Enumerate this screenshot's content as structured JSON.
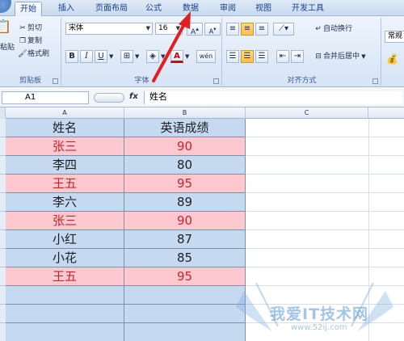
{
  "tabs": [
    "开始",
    "插入",
    "页面布局",
    "公式",
    "数据",
    "审阅",
    "视图",
    "开发工具"
  ],
  "active_tab": "开始",
  "clipboard": {
    "paste_label": "粘贴",
    "cut": "剪切",
    "copy": "复制",
    "format_painter": "格式刷",
    "group_label": "剪贴板"
  },
  "font": {
    "name": "宋体",
    "size": "16",
    "bold": "B",
    "italic": "I",
    "underline": "U",
    "color_letter": "A",
    "phonetic": "wén",
    "group_label": "字体"
  },
  "alignment": {
    "wrap_text": "自动换行",
    "merge_center": "合并后居中",
    "group_label": "对齐方式"
  },
  "number": {
    "format_value": "常规"
  },
  "formula_bar": {
    "name_box": "A1",
    "fx": "fx",
    "formula": "姓名"
  },
  "columns": [
    "A",
    "B",
    "C"
  ],
  "rows": [
    {
      "name": "姓名",
      "score": "英语成绩",
      "highlight": false
    },
    {
      "name": "张三",
      "score": "90",
      "highlight": true
    },
    {
      "name": "李四",
      "score": "80",
      "highlight": false
    },
    {
      "name": "王五",
      "score": "95",
      "highlight": true
    },
    {
      "name": "李六",
      "score": "89",
      "highlight": false
    },
    {
      "name": "张三",
      "score": "90",
      "highlight": true
    },
    {
      "name": "小红",
      "score": "87",
      "highlight": false
    },
    {
      "name": "小花",
      "score": "85",
      "highlight": false
    },
    {
      "name": "王五",
      "score": "95",
      "highlight": true
    },
    {
      "name": "",
      "score": "",
      "highlight": false
    },
    {
      "name": "",
      "score": "",
      "highlight": false
    },
    {
      "name": "",
      "score": "",
      "highlight": false
    }
  ],
  "colors": {
    "normal_fill": "#c5d9f1",
    "highlight_fill": "#ffc7ce",
    "highlight_text": "#c0282f",
    "normal_text": "#1f1f1f",
    "arrow": "#e02020"
  },
  "watermark": {
    "text": "我爱IT技术网",
    "url": "www.52ij.com"
  }
}
